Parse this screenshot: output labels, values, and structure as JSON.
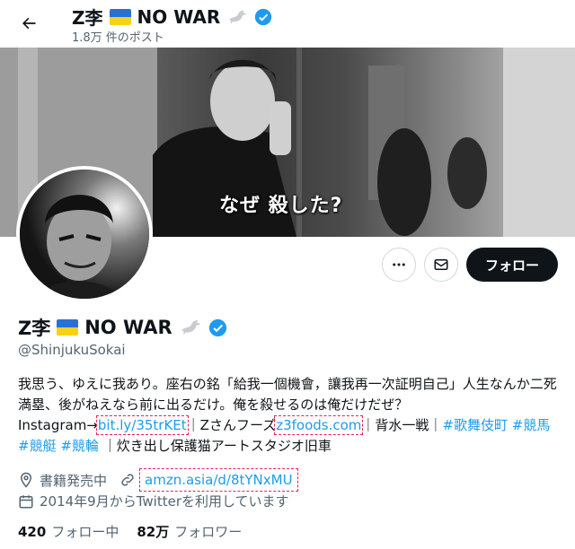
{
  "header": {
    "title_name": "Z李",
    "title_suffix": "NO WAR",
    "post_count": "1.8万 件のポスト",
    "back_icon": "arrow-left-icon"
  },
  "banner": {
    "caption": "なぜ 殺した?"
  },
  "actions": {
    "more_icon": "more-icon",
    "message_icon": "mail-icon",
    "follow_label": "フォロー"
  },
  "profile": {
    "name": "Z李",
    "name_suffix": "NO WAR",
    "handle": "@ShinjukuSokai",
    "bio": {
      "line1": "我思う、ゆえに我あり。座右の銘「給我一個機會，讓我再一次証明自己」人生なんか二死満塁、後がねえなら前に出るだけ。俺を殺せるのは俺だけだぜ？",
      "instagram_prefix": "Instagram→",
      "instagram_link": "bit.ly/35trKEt",
      "sep1": "｜Zさんフーズ",
      "foods_link": "z3foods.com",
      "sep2": "｜背水一戦｜",
      "tag1": "#歌舞伎町",
      "tag2": "#競馬",
      "tag3": "#競艇",
      "tag4": "#競輪",
      "tail": "｜炊き出し保護猫アートスタジオ旧車"
    },
    "location": "書籍発売中",
    "website": "amzn.asia/d/8tYNxMU",
    "joined": "2014年9月からTwitterを利用しています"
  },
  "stats": {
    "following_count": "420",
    "following_label": "フォロー中",
    "followers_count": "82万",
    "followers_label": "フォロワー"
  },
  "colors": {
    "accent": "#1d9bf0",
    "text": "#0f1419",
    "muted": "#536471",
    "verified": "#1d9bf0",
    "follow_bg": "#0f1419"
  }
}
